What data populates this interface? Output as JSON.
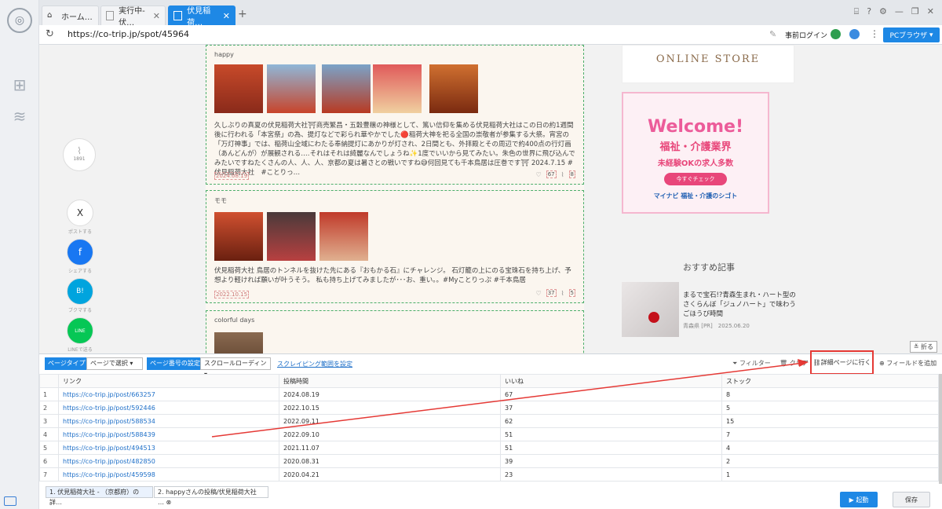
{
  "browser": {
    "tabs": [
      {
        "label": "ホーム…"
      },
      {
        "label": "実行中-伏…"
      },
      {
        "label": "伏見稲荷…"
      }
    ],
    "url": "https://co-trip.jp/spot/45964",
    "prelogin": "事前ログイン",
    "pc_browser": "PCブラウザ"
  },
  "content": {
    "posts": [
      {
        "user": "happy",
        "text": "久しぶりの真夏の伏見稲荷大社⛩商売繁昌・五穀豊穣の神様として、篤い信仰を集める伏見稲荷大社はこの日の約1週間後に行われる「本宮祭」の為、提灯などで彩られ華やかでした🔴稲荷大神を祀る全国の崇敬者が参集する大祭。宵宮の「万灯神事」では、稲荷山全域にわたる奉納提灯にあかりが灯され、2日間とも、外拝殿とその周辺で約400点の行灯画（あんどんが）が展観される‥‥それはそれは綺麗なんでしょうね✨1度でいいから見てみたい。朱色の世界に飛び込んでみたいですねたくさんの人、人、人、京都の夏は暑さとの戦いですね😅何回見ても千本鳥居は圧巻です⛩ 2024.7.15 #伏見稲荷大社　#ことりっ…",
        "date": "2024.08.19",
        "likes": "67",
        "stocks": "8"
      },
      {
        "user": "モモ",
        "text": "伏見稲荷大社 鳥居のトンネルを抜けた先にある『おもかる石』にチャレンジ。 石灯籠の上にのる宝珠石を持ち上げ、予想より軽ければ願いが叶うそう。 私も持ち上げてみましたが･･･お、重い。。#Myことりっぷ #千本鳥居",
        "date": "2022.10.15",
        "likes": "37",
        "stocks": "5"
      },
      {
        "user": "colorful days"
      }
    ],
    "sns": [
      {
        "label": "ポストする",
        "icon": "X"
      },
      {
        "label": "シェアする",
        "icon": "f"
      },
      {
        "label": "ブクマする",
        "icon": "B!"
      },
      {
        "label": "LINEで送る",
        "icon": "LINE"
      }
    ],
    "clip_count": "1891",
    "store_label": "ONLINE STORE",
    "ad": {
      "welcome": "Welcome!",
      "line1": "福祉・介護業界",
      "line2": "未経験OKの求人多数",
      "button": "今すぐチェック",
      "brand": "マイナビ 福祉・介護のシゴト"
    },
    "recommend": {
      "heading": "おすすめ記事",
      "title": "まるで宝石!?青森生まれ・ハート型のさくらんぼ「ジュノハート」で味わうごほうび時間",
      "meta": "青森県 [PR]　2025.06.20"
    },
    "fold_label": "折る"
  },
  "panel": {
    "page_type_label": "ページタイプ",
    "page_type_value": "ページで選択",
    "page_num_label": "ページ番号の設定",
    "page_num_value": "スクロールローディン",
    "scrape_range": "スクレイピング範囲を設定",
    "filter": "フィルター",
    "clear": "クリア",
    "detail": "詳細ページに行く",
    "add_field": "フィールドを追加",
    "columns": [
      "",
      "リンク",
      "投稿時間",
      "いいね",
      "ストック"
    ],
    "rows": [
      [
        "1",
        "https://co-trip.jp/post/663257",
        "2024.08.19",
        "67",
        "8"
      ],
      [
        "2",
        "https://co-trip.jp/post/592446",
        "2022.10.15",
        "37",
        "5"
      ],
      [
        "3",
        "https://co-trip.jp/post/588534",
        "2022.09.11",
        "62",
        "15"
      ],
      [
        "4",
        "https://co-trip.jp/post/588439",
        "2022.09.10",
        "51",
        "7"
      ],
      [
        "5",
        "https://co-trip.jp/post/494513",
        "2021.11.07",
        "51",
        "4"
      ],
      [
        "6",
        "https://co-trip.jp/post/482850",
        "2020.08.31",
        "39",
        "2"
      ],
      [
        "7",
        "https://co-trip.jp/post/459598",
        "2020.04.21",
        "23",
        "1"
      ]
    ],
    "bottom_tabs": [
      "1. 伏見稲荷大社 - （京都府）の詳…",
      "2. happyさんの投稿/伏見稲荷大社 …"
    ],
    "start": "起動",
    "save": "保存"
  },
  "colors": {
    "accent": "#1e88e5",
    "highlight": "#e53935"
  }
}
